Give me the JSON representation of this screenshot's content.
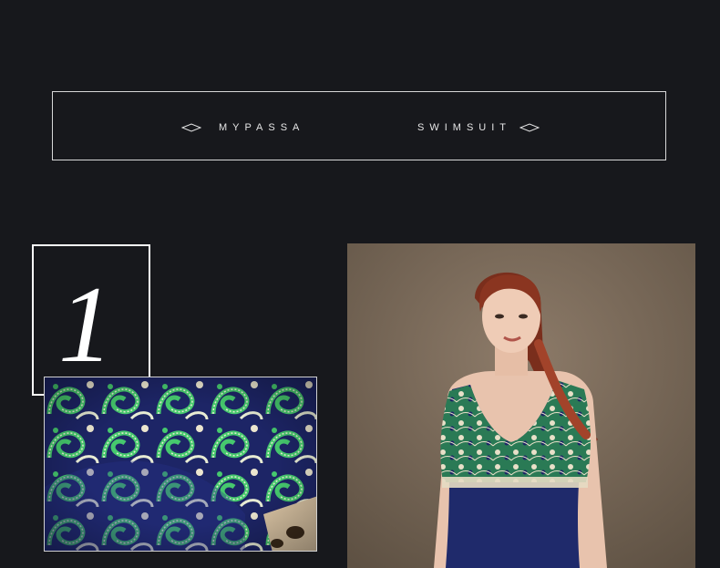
{
  "banner": {
    "brand": "MYPASSA",
    "product": "SWIMSUIT"
  },
  "section": {
    "numeral": "1"
  },
  "images": {
    "detail": "paisley-fabric-closeup",
    "model": "model-in-swimsuit"
  },
  "colors": {
    "background": "#17181c",
    "frame": "#ffffff",
    "swimsuit_navy": "#1f2a6b",
    "paisley_green": "#3fbf6a",
    "studio_backdrop": "#7e6d5c"
  }
}
